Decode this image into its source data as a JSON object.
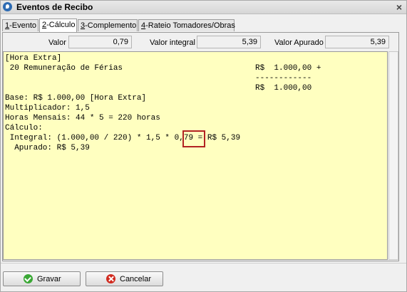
{
  "window": {
    "title": "Eventos de Recibo",
    "close": "×"
  },
  "tabs": [
    {
      "key": "1",
      "label": "-Evento"
    },
    {
      "key": "2",
      "label": "-Cálculo"
    },
    {
      "key": "3",
      "label": "-Complemento"
    },
    {
      "key": "4",
      "label": "-Rateio Tomadores/Obras"
    }
  ],
  "fields": {
    "valor_label": "Valor",
    "valor_value": "0,79",
    "integral_label": "Valor integral",
    "integral_value": "5,39",
    "apurado_label": "Valor Apurado",
    "apurado_value": "5,39"
  },
  "memo": {
    "line1": "[Hora Extra]",
    "line2": " 20 Remuneração de Férias",
    "line2_amount": "R$  1.000,00 +",
    "line3_dashes": "------------",
    "line4_amount": "R$  1.000,00",
    "line5": "Base: R$ 1.000,00 [Hora Extra]",
    "line6": "Multiplicador: 1,5",
    "line7": "Horas Mensais: 44 * 5 = 220 horas",
    "line8": "Cálculo:",
    "line9": " Integral: (1.000,00 / 220) * 1,5 * 0,79 = R$ 5,39",
    "line10": "  Apurado: R$ 5,39"
  },
  "buttons": {
    "save": "Gravar",
    "cancel": "Cancelar"
  },
  "colors": {
    "memo_bg": "#ffffc0",
    "highlight": "#b22222"
  }
}
